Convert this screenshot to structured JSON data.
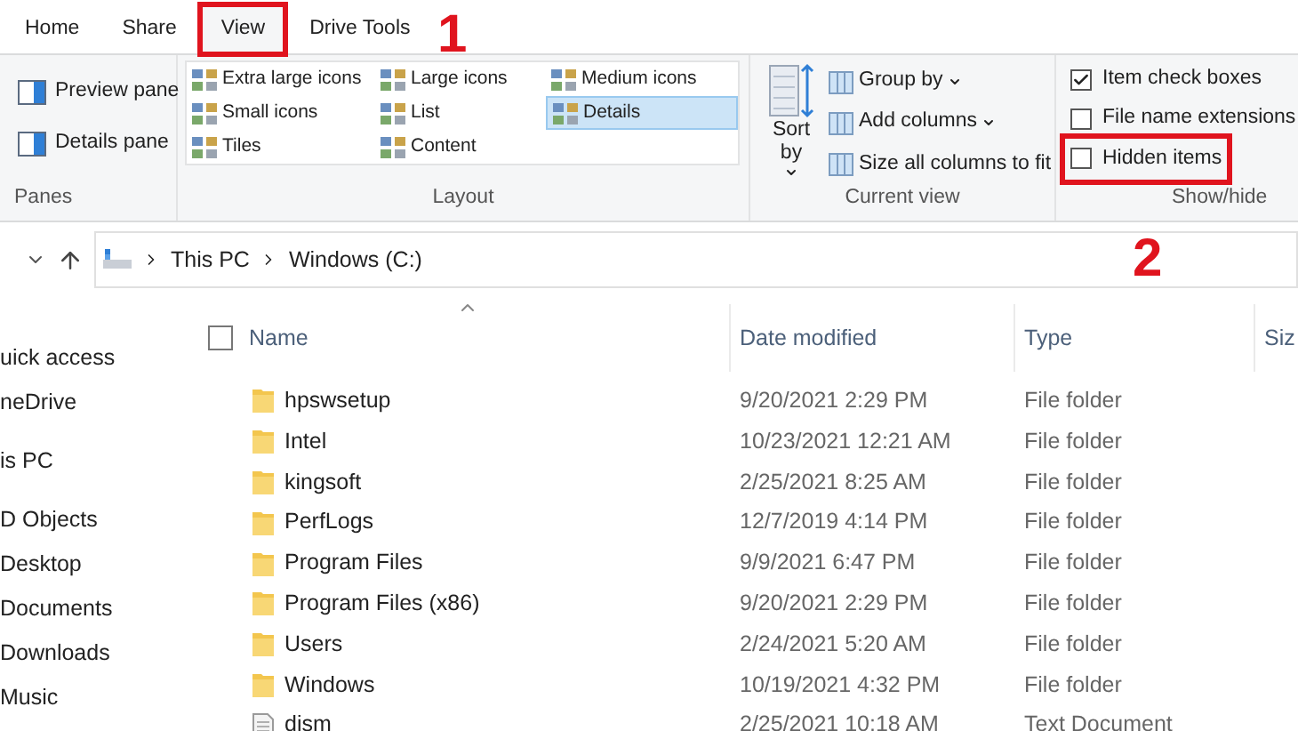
{
  "tabs": [
    {
      "label": "Home",
      "selected": false,
      "outlined": false
    },
    {
      "label": "Share",
      "selected": false,
      "outlined": false
    },
    {
      "label": "View",
      "selected": true,
      "outlined": true
    },
    {
      "label": "Drive Tools",
      "selected": false,
      "outlined": false
    }
  ],
  "annotations": [
    {
      "label": "1"
    },
    {
      "label": "2"
    }
  ],
  "ribbon": {
    "panes": {
      "title": "Panes",
      "items": [
        "Preview pane",
        "Details pane"
      ]
    },
    "layout": {
      "title": "Layout",
      "options": [
        {
          "label": "Extra large icons",
          "selected": false
        },
        {
          "label": "Large icons",
          "selected": false
        },
        {
          "label": "Medium icons",
          "selected": false
        },
        {
          "label": "Small icons",
          "selected": false
        },
        {
          "label": "List",
          "selected": false
        },
        {
          "label": "Details",
          "selected": true
        },
        {
          "label": "Tiles",
          "selected": false
        },
        {
          "label": "Content",
          "selected": false
        }
      ]
    },
    "current_view": {
      "title": "Current view",
      "sort_label": "Sort by",
      "items": [
        {
          "label": "Group by",
          "dropdown": true
        },
        {
          "label": "Add columns",
          "dropdown": true
        },
        {
          "label": "Size all columns to fit",
          "dropdown": false
        }
      ]
    },
    "show_hide": {
      "title": "Show/hide",
      "options": [
        {
          "label": "Item check boxes",
          "checked": true,
          "outlined": false
        },
        {
          "label": "File name extensions",
          "checked": false,
          "outlined": false
        },
        {
          "label": "Hidden items",
          "checked": false,
          "outlined": true
        }
      ]
    }
  },
  "address": {
    "crumbs": [
      "This PC",
      "Windows (C:)"
    ]
  },
  "nav_items": [
    "uick access",
    "neDrive",
    "is PC",
    "D Objects",
    "Desktop",
    "Documents",
    "Downloads",
    "Music"
  ],
  "select_all_checked": false,
  "columns": [
    "Name",
    "Date modified",
    "Type",
    "Siz"
  ],
  "rows": [
    {
      "name": "hpswsetup",
      "date": "9/20/2021 2:29 PM",
      "type": "File folder",
      "kind": "folder"
    },
    {
      "name": "Intel",
      "date": "10/23/2021 12:21 AM",
      "type": "File folder",
      "kind": "folder"
    },
    {
      "name": "kingsoft",
      "date": "2/25/2021 8:25 AM",
      "type": "File folder",
      "kind": "folder"
    },
    {
      "name": "PerfLogs",
      "date": "12/7/2019 4:14 PM",
      "type": "File folder",
      "kind": "folder"
    },
    {
      "name": "Program Files",
      "date": "9/9/2021 6:47 PM",
      "type": "File folder",
      "kind": "folder"
    },
    {
      "name": "Program Files (x86)",
      "date": "9/20/2021 2:29 PM",
      "type": "File folder",
      "kind": "folder"
    },
    {
      "name": "Users",
      "date": "2/24/2021 5:20 AM",
      "type": "File folder",
      "kind": "folder"
    },
    {
      "name": "Windows",
      "date": "10/19/2021 4:32 PM",
      "type": "File folder",
      "kind": "folder"
    },
    {
      "name": "dism",
      "date": "2/25/2021 10:18 AM",
      "type": "Text Document",
      "kind": "file"
    }
  ]
}
